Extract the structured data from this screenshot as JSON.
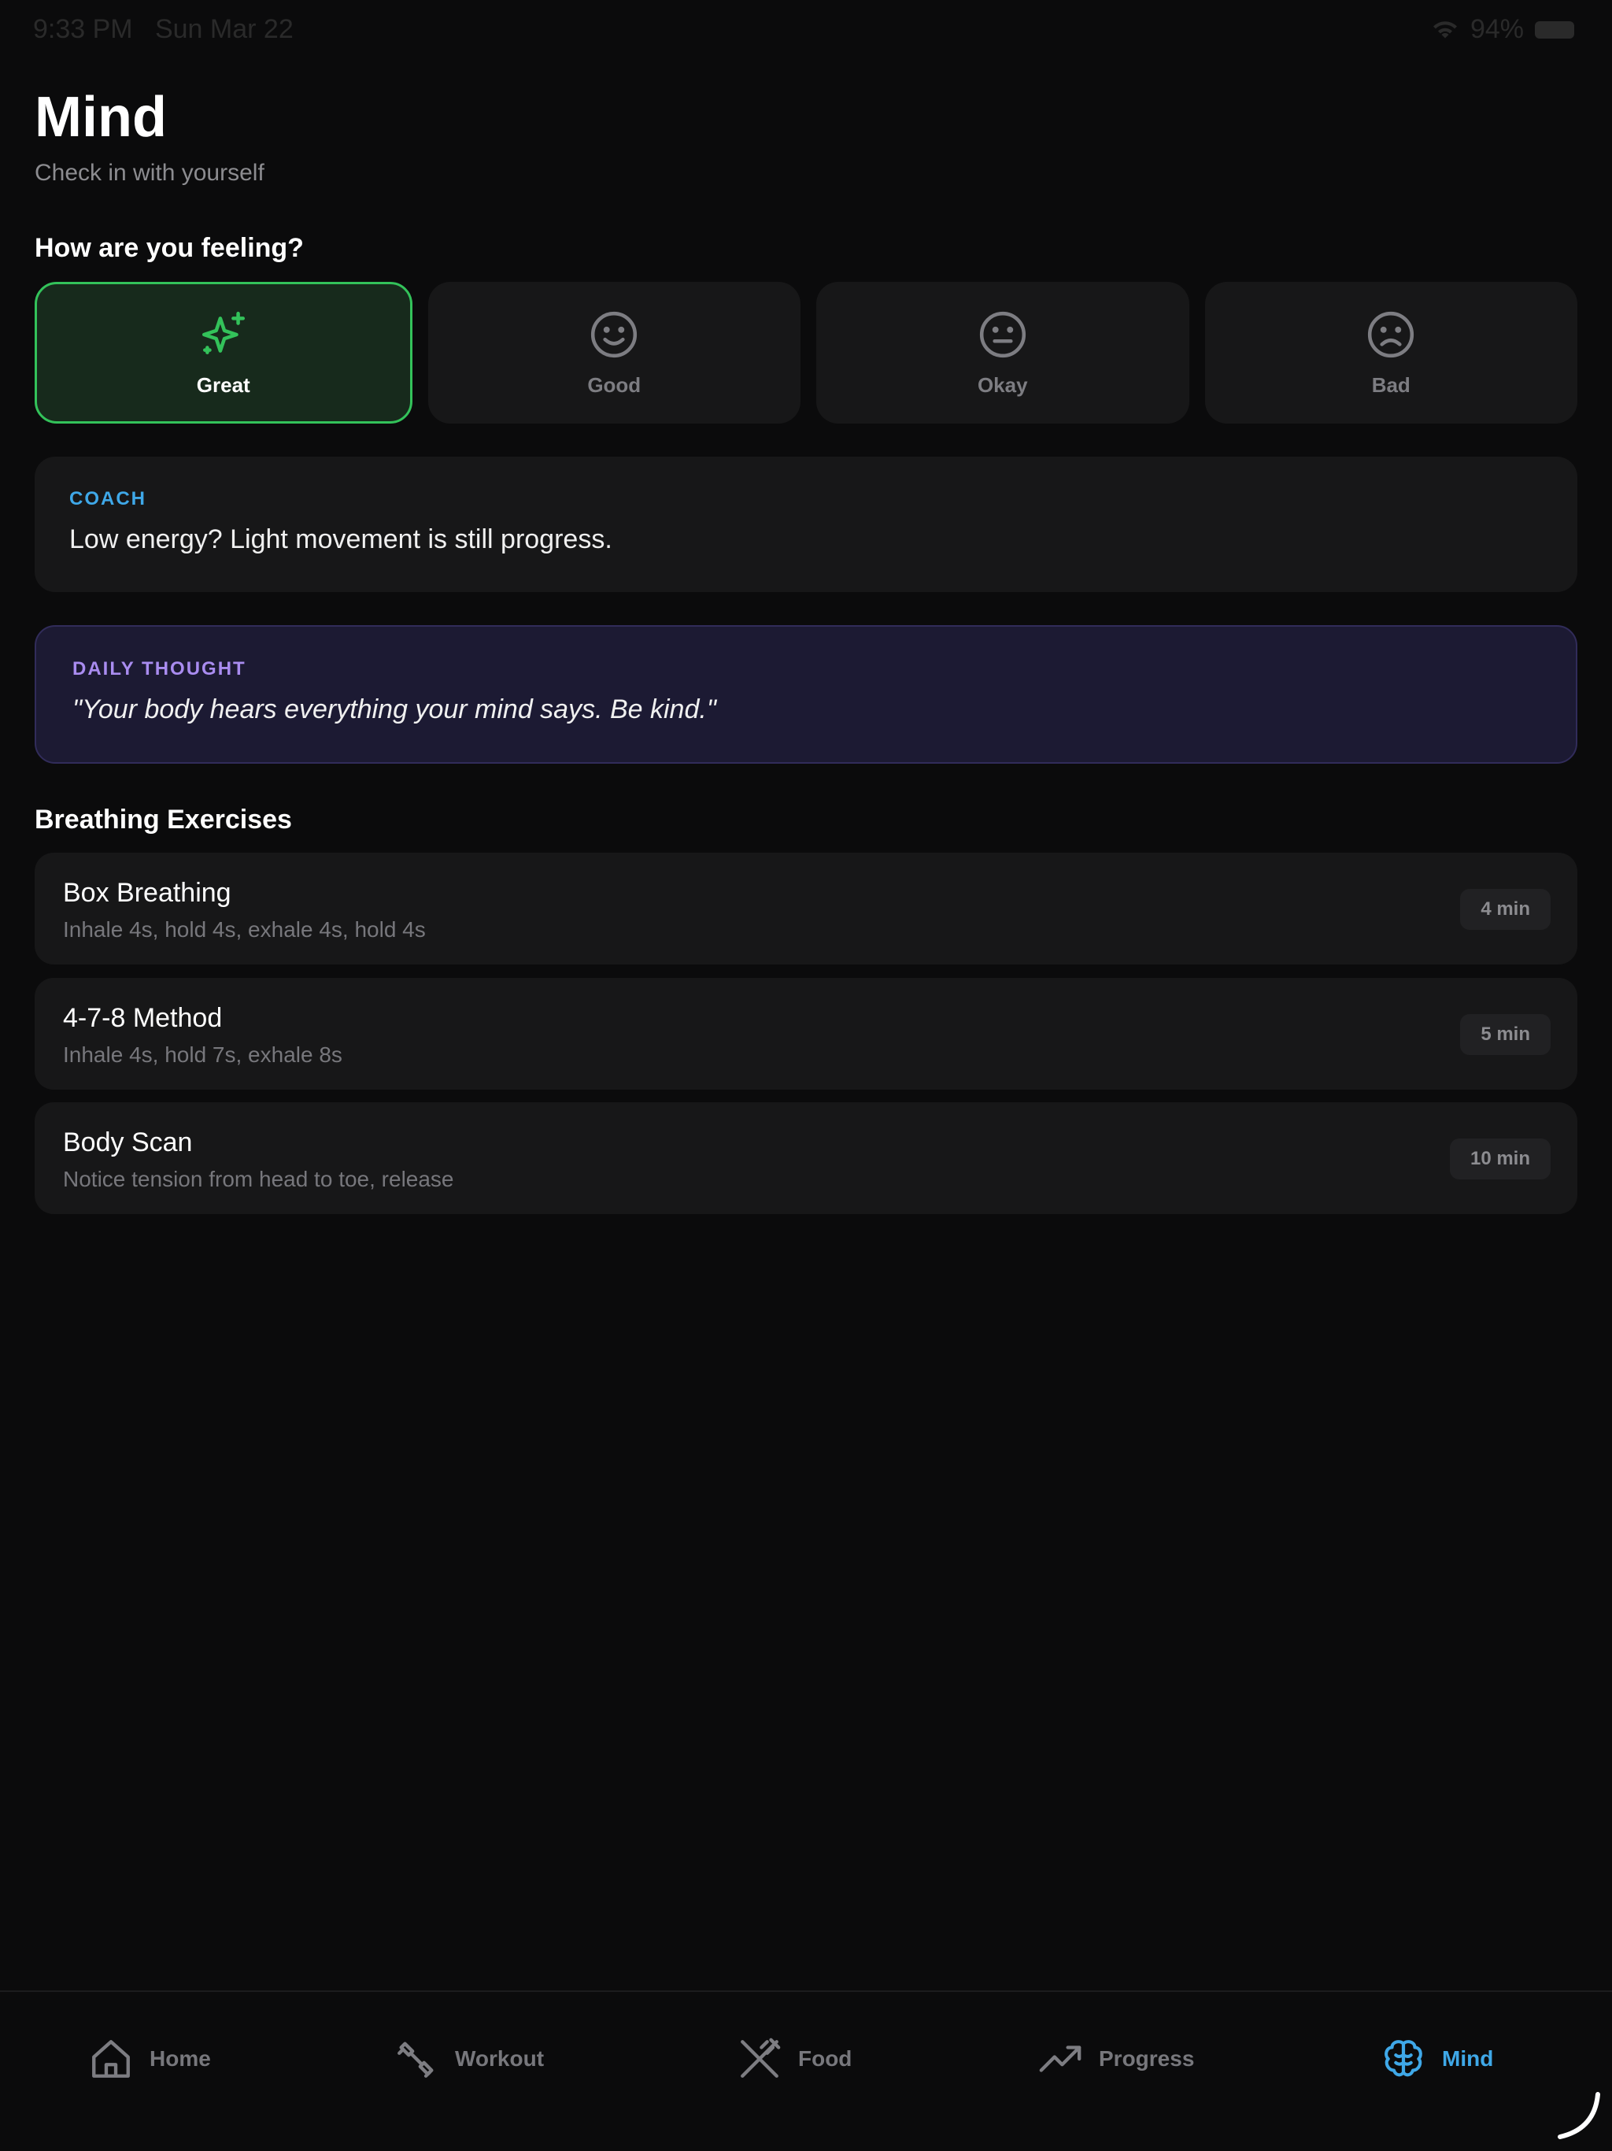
{
  "status": {
    "time": "9:33 PM",
    "date": "Sun Mar 22",
    "battery": "94%"
  },
  "header": {
    "title": "Mind",
    "subtitle": "Check in with yourself"
  },
  "mood": {
    "heading": "How are you feeling?",
    "options": [
      {
        "label": "Great",
        "icon": "sparkle-icon",
        "selected": true
      },
      {
        "label": "Good",
        "icon": "smile-icon",
        "selected": false
      },
      {
        "label": "Okay",
        "icon": "neutral-face-icon",
        "selected": false
      },
      {
        "label": "Bad",
        "icon": "frown-icon",
        "selected": false
      }
    ]
  },
  "coach": {
    "tag": "COACH",
    "message": "Low energy? Light movement is still progress."
  },
  "thought": {
    "tag": "DAILY THOUGHT",
    "message": "\"Your body hears everything your mind says. Be kind.\""
  },
  "breathing": {
    "heading": "Breathing Exercises",
    "items": [
      {
        "name": "Box Breathing",
        "desc": "Inhale 4s, hold 4s, exhale 4s, hold 4s",
        "duration": "4 min"
      },
      {
        "name": "4-7-8 Method",
        "desc": "Inhale 4s, hold 7s, exhale 8s",
        "duration": "5 min"
      },
      {
        "name": "Body Scan",
        "desc": "Notice tension from head to toe, release",
        "duration": "10 min"
      }
    ]
  },
  "tabs": [
    {
      "label": "Home",
      "icon": "home-icon",
      "active": false
    },
    {
      "label": "Workout",
      "icon": "dumbbell-icon",
      "active": false
    },
    {
      "label": "Food",
      "icon": "utensils-icon",
      "active": false
    },
    {
      "label": "Progress",
      "icon": "trending-up-icon",
      "active": false
    },
    {
      "label": "Mind",
      "icon": "brain-icon",
      "active": true
    }
  ],
  "colors": {
    "accent_green": "#33c25a",
    "accent_blue": "#3fa8e8",
    "accent_purple": "#a98cf0",
    "background": "#0b0b0c"
  }
}
